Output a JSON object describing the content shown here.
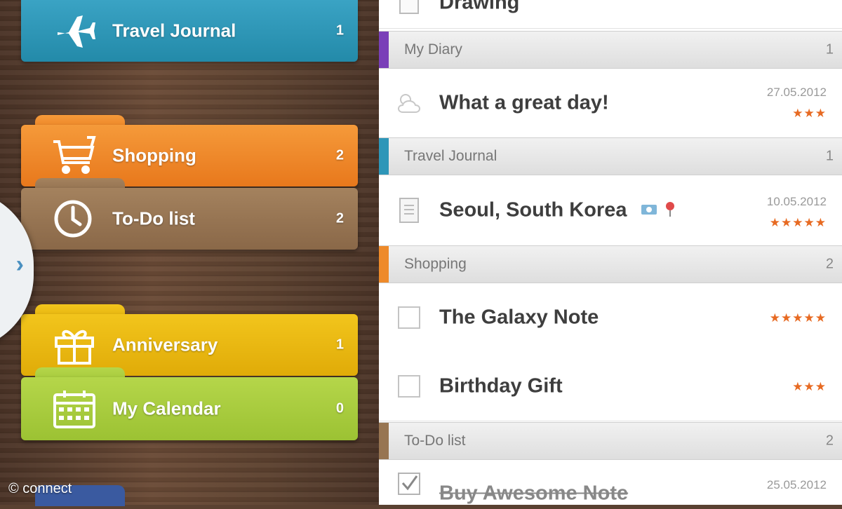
{
  "sidebar": {
    "folders": [
      {
        "label": "Travel Journal",
        "count": "1",
        "icon": "airplane-icon"
      },
      {
        "label": "Shopping",
        "count": "2",
        "icon": "cart-icon"
      },
      {
        "label": "To-Do list",
        "count": "2",
        "icon": "clock-icon"
      },
      {
        "label": "Anniversary",
        "count": "1",
        "icon": "gift-icon"
      },
      {
        "label": "My Calendar",
        "count": "0",
        "icon": "calendar-icon"
      }
    ],
    "expand_icon": "chevron-right-icon",
    "colors": {
      "travel": "#2e96b8",
      "shopping": "#ee8a2a",
      "todo": "#977552",
      "anniversary": "#ebb812",
      "calendar": "#a9cc3e"
    }
  },
  "watermark": "© connect",
  "list": {
    "top_item": {
      "title": "Drawing"
    },
    "sections": [
      {
        "title": "My Diary",
        "count": "1",
        "color": "#7a3fb8",
        "items": [
          {
            "title": "What a great day!",
            "date": "27.05.2012",
            "stars": "★★★",
            "icon": "weather-icon"
          }
        ]
      },
      {
        "title": "Travel Journal",
        "count": "1",
        "color": "#2e96b8",
        "items": [
          {
            "title": "Seoul, South Korea",
            "date": "10.05.2012",
            "stars": "★★★★★",
            "icon": "document-icon"
          }
        ]
      },
      {
        "title": "Shopping",
        "count": "2",
        "color": "#ee8a2a",
        "items": [
          {
            "title": "The Galaxy Note",
            "stars": "★★★★★",
            "icon": "checkbox-icon"
          },
          {
            "title": "Birthday Gift",
            "stars": "★★★",
            "icon": "checkbox-icon"
          }
        ]
      },
      {
        "title": "To-Do list",
        "count": "2",
        "color": "#977552",
        "items": [
          {
            "title": "Buy Awesome Note",
            "date": "25.05.2012",
            "icon": "checked-checkbox-icon"
          }
        ]
      }
    ]
  }
}
